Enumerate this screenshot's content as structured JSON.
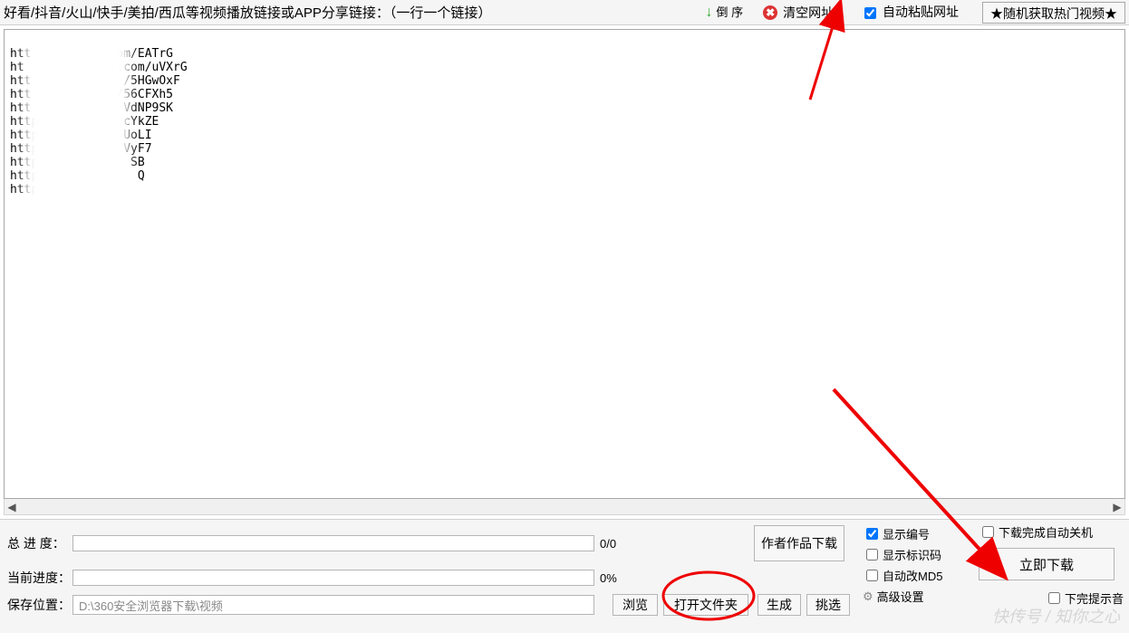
{
  "top": {
    "title": "好看/抖音/火山/快手/美拍/西瓜等视频播放链接或APP分享链接：（一行一个链接）",
    "reverse": "倒\n序",
    "clear": "清空网址",
    "auto_paste": "自动粘贴网址",
    "random_hot": "★随机获取热门视频★"
  },
  "urls": "htt         k.com/EATrG\nht       x.    .com/uVXrG\nhtt       /     /5HGwOxF\nhtt     /u     /56CFXh5\nhtt      url    VdNP9SK\nhttp     url.   cYkZE\nhttp    url.    UoLI\nhttp    rl.c    VyF7\nhttps   rl.cn    SB\nhttps   rl.cn/    Q\nhttps   rl.cn/t    ",
  "bottom": {
    "total_label": "总 进 度：",
    "total_pct": "0/0",
    "curr_label": "当前进度：",
    "curr_pct": "0%",
    "save_label": "保存位置：",
    "save_path": "D:\\360安全浏览器下载\\视频",
    "browse": "浏览",
    "open_folder": "打开文件夹",
    "author_dl": "作者作品下载",
    "gen": "生成",
    "pick": "挑选",
    "show_num": "显示编号",
    "show_id": "显示标识码",
    "auto_md5": "自动改MD5",
    "adv": "高级设置",
    "shutdown": "下载完成自动关机",
    "start": "立即下载",
    "sound": "下完提示音"
  },
  "watermark": "快传号 / 知你之心"
}
